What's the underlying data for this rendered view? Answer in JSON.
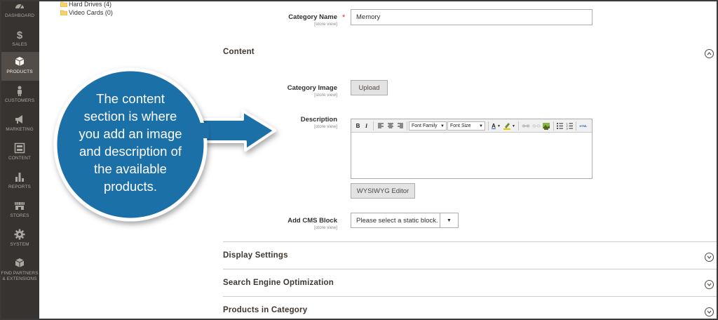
{
  "sidebar": {
    "items": [
      {
        "label": "DASHBOARD",
        "icon": "dashboard-icon"
      },
      {
        "label": "SALES",
        "icon": "dollar-icon"
      },
      {
        "label": "PRODUCTS",
        "icon": "cube-icon",
        "active": true
      },
      {
        "label": "CUSTOMERS",
        "icon": "person-icon"
      },
      {
        "label": "MARKETING",
        "icon": "megaphone-icon"
      },
      {
        "label": "CONTENT",
        "icon": "layout-icon"
      },
      {
        "label": "REPORTS",
        "icon": "bar-chart-icon"
      },
      {
        "label": "STORES",
        "icon": "storefront-icon"
      },
      {
        "label": "SYSTEM",
        "icon": "gear-icon"
      },
      {
        "label": "FIND PARTNERS\n& EXTENSIONS",
        "icon": "extensions-icon"
      }
    ],
    "colors": {
      "background": "#373330",
      "active": "#524d49"
    }
  },
  "tree": {
    "items": [
      "Hard Drives (4)",
      "Video Cards (0)"
    ]
  },
  "form": {
    "category_name": {
      "label": "Category Name",
      "scope": "[store view]",
      "value": "Memory",
      "required": true
    },
    "content_section": {
      "title": "Content",
      "expanded": true
    },
    "category_image": {
      "label": "Category Image",
      "scope": "[store view]",
      "button": "Upload"
    },
    "description": {
      "label": "Description",
      "scope": "[store view]",
      "toolbar": {
        "bold": "B",
        "italic": "I",
        "font_family": "Font Family",
        "font_size": "Font Size",
        "text_color": "A",
        "html": "HTML"
      },
      "wysiwyg_button": "WYSIWYG Editor"
    },
    "cms_block": {
      "label": "Add CMS Block",
      "scope": "[store view]",
      "placeholder": "Please select a static block."
    }
  },
  "sections": [
    {
      "title": "Display Settings",
      "expanded": false
    },
    {
      "title": "Search Engine Optimization",
      "expanded": false
    },
    {
      "title": "Products in Category",
      "expanded": false
    }
  ],
  "callout": {
    "text": "The content\nsection is where\nyou add an image\nand description of\nthe available\nproducts.",
    "colors": {
      "fill": "#1e6fa8",
      "border": "#ffffff"
    }
  }
}
